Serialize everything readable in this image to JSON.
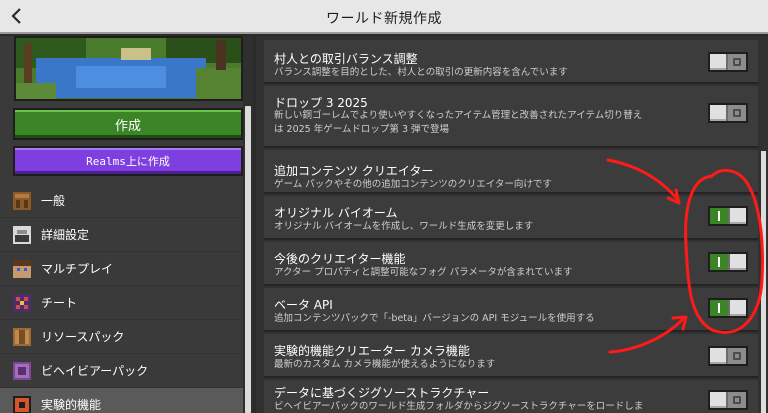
{
  "header": {
    "title": "ワールド新規作成",
    "back_icon": "chevron-left-icon"
  },
  "buttons": {
    "create": "作成",
    "realms_prefix": "Realms",
    "realms_suffix": " 上に作成"
  },
  "sidebar": {
    "items": [
      {
        "label": "一般",
        "icon": "crafting-table-icon"
      },
      {
        "label": "詳細設定",
        "icon": "advanced-icon"
      },
      {
        "label": "マルチプレイ",
        "icon": "players-icon"
      },
      {
        "label": "チート",
        "icon": "cheat-icon"
      },
      {
        "label": "リソースパック",
        "icon": "resource-pack-icon"
      },
      {
        "label": "ビヘイビアーパック",
        "icon": "behavior-pack-icon"
      },
      {
        "label": "実験的機能",
        "icon": "experimental-icon",
        "active": true
      }
    ]
  },
  "settings": [
    {
      "title": "村人との取引バランス調整",
      "desc": [
        "バランス調整を目的とした、村人との取引の更新内容を含んでいます"
      ],
      "enabled": false
    },
    {
      "title": "ドロップ 3 2025",
      "desc": [
        "新しい銅ゴーレムでより使いやすくなったアイテム管理と改善されたアイテム切り替え",
        "は 2025 年ゲームドロップ第 3 弾で登場"
      ],
      "enabled": false
    },
    {
      "title": "追加コンテンツ クリエイター",
      "desc": [
        "ゲーム パックやその他の追加コンテンツのクリエイター向けです"
      ],
      "enabled": null
    },
    {
      "title": "オリジナル バイオーム",
      "desc": [
        "オリジナル バイオームを作成し、ワールド生成を変更します"
      ],
      "enabled": true
    },
    {
      "title": "今後のクリエイター機能",
      "desc": [
        "アクター プロパティと調整可能なフォグ パラメータが含まれています"
      ],
      "enabled": true
    },
    {
      "title": "ベータ API",
      "desc": [
        "追加コンテンツパックで「-beta」バージョンの API モジュールを使用する"
      ],
      "enabled": true
    },
    {
      "title": "実験的機能クリエーター カメラ機能",
      "desc": [
        "最新のカスタム カメラ機能が使えるようになります"
      ],
      "enabled": false
    },
    {
      "title": "データに基づくジグソーストラクチャー",
      "desc": [
        "ビヘイビアーパックのワールド生成フォルダからジグソーストラクチャーをロードしま"
      ],
      "enabled": false
    }
  ],
  "colors": {
    "accent_green": "#3c8527",
    "realms_purple": "#7f3fe0",
    "annotation_red": "#ff0000"
  }
}
